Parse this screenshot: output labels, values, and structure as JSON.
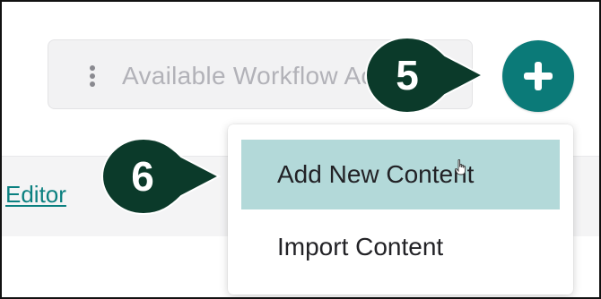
{
  "workflow_select": {
    "placeholder": "Available Workflow Actions"
  },
  "add_button": {
    "icon": "plus-icon"
  },
  "dropdown": {
    "items": [
      {
        "label": "Add New Content",
        "highlighted": true
      },
      {
        "label": "Import Content",
        "highlighted": false
      }
    ]
  },
  "editor_link": "Editor",
  "callouts": [
    {
      "number": "5",
      "points_to": "add-button"
    },
    {
      "number": "6",
      "points_to": "add-new-content-menu-item"
    }
  ],
  "colors": {
    "teal_button": "#0b7a78",
    "callout_fill": "#0b3a2a",
    "menu_highlight": "#b3d9d9",
    "link": "#0b8080"
  }
}
